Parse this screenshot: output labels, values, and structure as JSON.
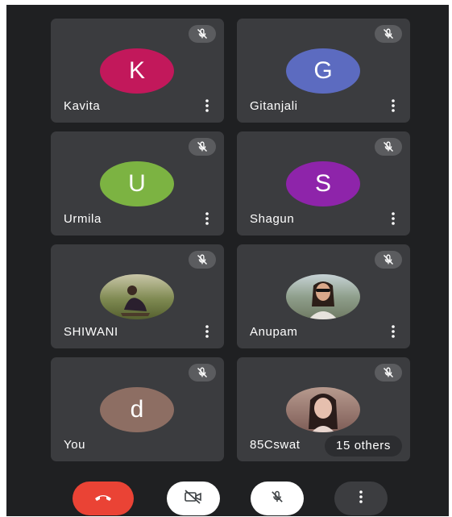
{
  "participants": [
    {
      "name": "Kavita",
      "initial": "K",
      "avatar_color": "#c2185b",
      "type": "initial"
    },
    {
      "name": "Gitanjali",
      "initial": "G",
      "avatar_color": "#5c6bc0",
      "type": "initial"
    },
    {
      "name": "Urmila",
      "initial": "U",
      "avatar_color": "#7cb342",
      "type": "initial"
    },
    {
      "name": "Shagun",
      "initial": "S",
      "avatar_color": "#8e24aa",
      "type": "initial"
    },
    {
      "name": "SHIWANI",
      "initial": "",
      "avatar_color": "#6d7a4a",
      "type": "photo"
    },
    {
      "name": "Anupam",
      "initial": "",
      "avatar_color": "#9aa7a3",
      "type": "photo"
    },
    {
      "name": "You",
      "initial": "d",
      "avatar_color": "#8d6e63",
      "type": "initial"
    },
    {
      "name": "85Cswat",
      "initial": "",
      "avatar_color": "#a58479",
      "type": "photo"
    }
  ],
  "others_badge": "15 others",
  "controls": {
    "end_call_color": "#ea4335",
    "icons": [
      "end-call-icon",
      "camera-off-icon",
      "mic-off-icon",
      "more-options-icon"
    ]
  },
  "colors": {
    "background": "#1f2022",
    "tile": "#3b3c3f"
  }
}
